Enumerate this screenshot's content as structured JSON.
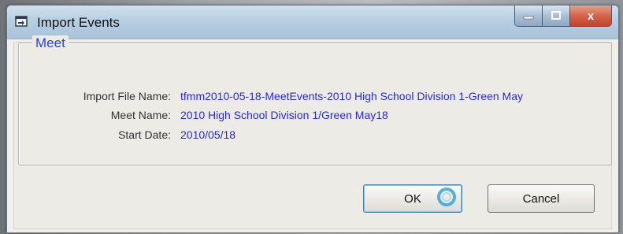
{
  "window": {
    "title": "Import Events",
    "controls": {
      "minimize": "–",
      "maximize": "□",
      "close": "x"
    }
  },
  "group": {
    "label": "Meet",
    "fields": [
      {
        "label": "Import File Name:",
        "value": "tfmm2010-05-18-MeetEvents-2010 High School Division 1-Green May"
      },
      {
        "label": "Meet Name:",
        "value": "2010 High School Division 1/Green May18"
      },
      {
        "label": "Start Date:",
        "value": "2010/05/18"
      }
    ]
  },
  "buttons": {
    "ok": "OK",
    "cancel": "Cancel"
  },
  "colors": {
    "accent_text": "#2a2ad0",
    "group_label": "#2a44c8",
    "titlebar": "#b8cfe3",
    "close_button": "#d4634a"
  }
}
